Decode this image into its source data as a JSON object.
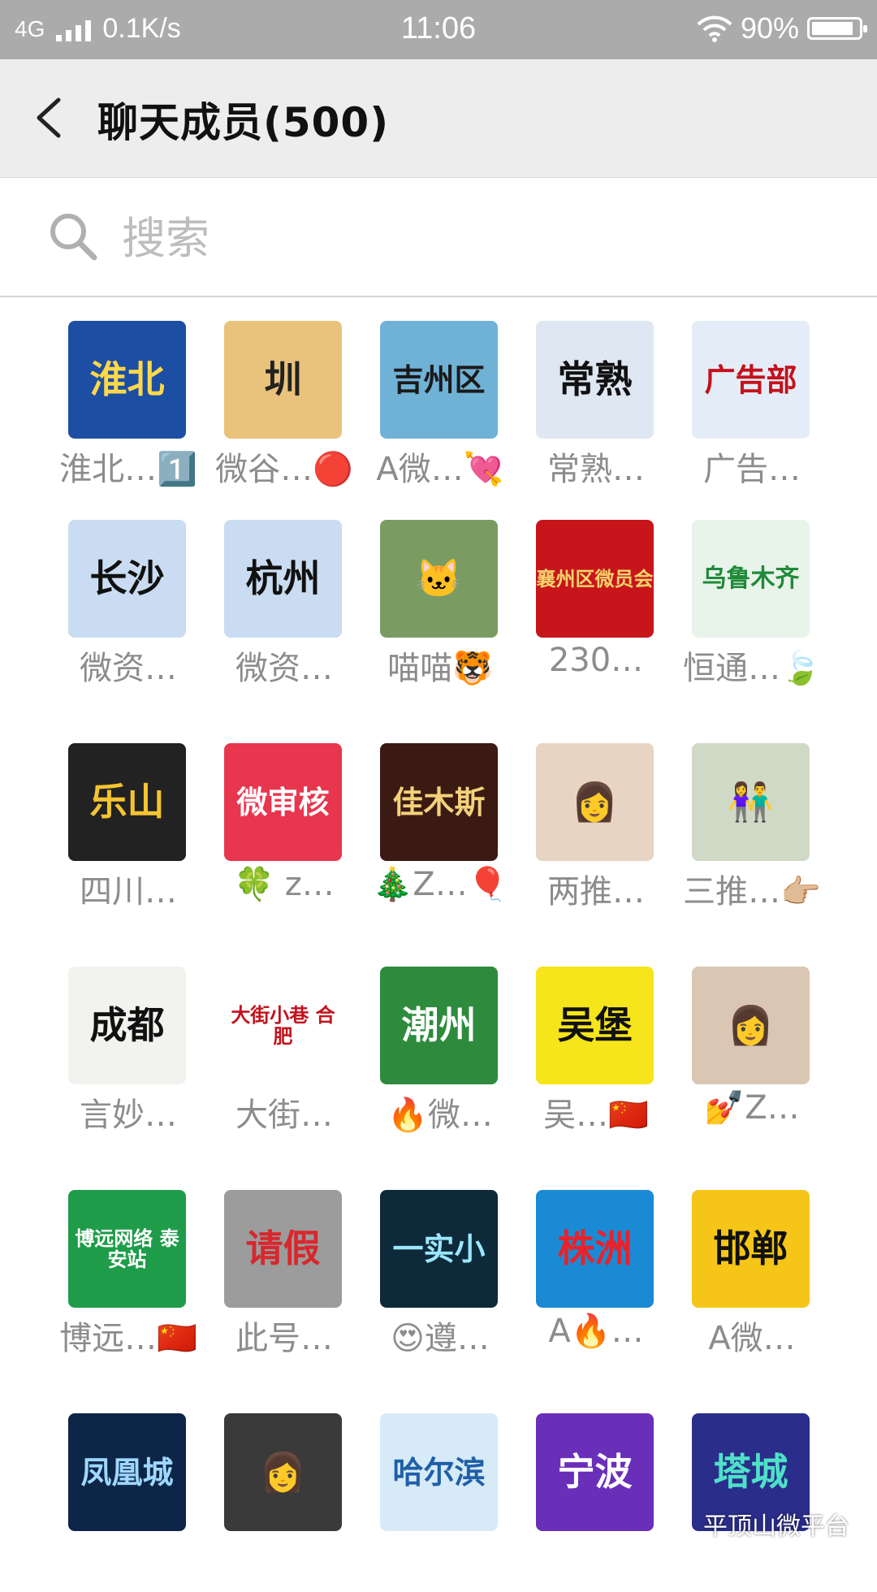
{
  "status_bar": {
    "network": "4G",
    "speed": "0.1K/s",
    "time": "11:06",
    "battery": "90%",
    "battery_level": 0.9
  },
  "nav": {
    "title": "聊天成员(500)"
  },
  "search": {
    "placeholder": "搜索"
  },
  "members": [
    {
      "name": "淮北…1️⃣",
      "avatar_text": "淮北",
      "bg": "#1c4fa3",
      "fg": "#ffd84a"
    },
    {
      "name": "微谷…🔴",
      "avatar_text": "圳",
      "bg": "#e9c27b",
      "fg": "#222222"
    },
    {
      "name": "A微…💘",
      "avatar_text": "吉州区",
      "bg": "#6fb2d6",
      "fg": "#1a1a1a"
    },
    {
      "name": "常熟…",
      "avatar_text": "常熟",
      "bg": "#dfe7f2",
      "fg": "#111111"
    },
    {
      "name": "广告…",
      "avatar_text": "广告部",
      "bg": "#e4edf7",
      "fg": "#c3121c"
    },
    {
      "name": "微资…",
      "avatar_text": "长沙",
      "bg": "#c9dcf2",
      "fg": "#111111"
    },
    {
      "name": "微资…",
      "avatar_text": "杭州",
      "bg": "#c9dcf2",
      "fg": "#111111"
    },
    {
      "name": "喵喵🐯",
      "avatar_text": "🐱",
      "bg": "#7a9c63",
      "fg": "#ffffff"
    },
    {
      "name": "230…",
      "avatar_text": "襄州区微员会",
      "bg": "#c8151b",
      "fg": "#f4d36b"
    },
    {
      "name": "恒通…🍃",
      "avatar_text": "乌鲁木齐",
      "bg": "#e8f3e9",
      "fg": "#1f8a3a"
    },
    {
      "name": "四川…",
      "avatar_text": "乐山",
      "bg": "#222222",
      "fg": "#f4c430"
    },
    {
      "name": "🍀 z…",
      "avatar_text": "微审核",
      "bg": "#e8364f",
      "fg": "#ffffff"
    },
    {
      "name": "🎄Z…🎈",
      "avatar_text": "佳木斯",
      "bg": "#3b1a14",
      "fg": "#f3d27a"
    },
    {
      "name": "两推…",
      "avatar_text": "👩",
      "bg": "#e7d4c2",
      "fg": "#5a3b2a"
    },
    {
      "name": "三推…👉🏼",
      "avatar_text": "👫",
      "bg": "#cfd9c6",
      "fg": "#333333"
    },
    {
      "name": "言妙…",
      "avatar_text": "成都",
      "bg": "#f2f2ee",
      "fg": "#111111"
    },
    {
      "name": "大街…",
      "avatar_text": "大街小巷 合肥",
      "bg": "#ffffff",
      "fg": "#c3121c"
    },
    {
      "name": "🔥微…",
      "avatar_text": "潮州",
      "bg": "#2e8b3e",
      "fg": "#ffffff"
    },
    {
      "name": "吴…🇨🇳",
      "avatar_text": "吴堡",
      "bg": "#f6e51b",
      "fg": "#111111"
    },
    {
      "name": "💅Z…",
      "avatar_text": "👩",
      "bg": "#d9c7b4",
      "fg": "#4a3526"
    },
    {
      "name": "博远…🇨🇳",
      "avatar_text": "博远网络 泰安站",
      "bg": "#1f9c4a",
      "fg": "#ffffff"
    },
    {
      "name": "此号…",
      "avatar_text": "请假",
      "bg": "#9c9c9c",
      "fg": "#d6282e"
    },
    {
      "name": "😍遵…",
      "avatar_text": "一实小",
      "bg": "#0e2a3a",
      "fg": "#9be7ff"
    },
    {
      "name": "A🔥…",
      "avatar_text": "株洲",
      "bg": "#1a8ad4",
      "fg": "#e8222a"
    },
    {
      "name": "A微…",
      "avatar_text": "邯郸",
      "bg": "#f5c518",
      "fg": "#111111"
    },
    {
      "name": "",
      "avatar_text": "凤凰城",
      "bg": "#0d2547",
      "fg": "#9fd8ff"
    },
    {
      "name": "",
      "avatar_text": "👩",
      "bg": "#3a3a3a",
      "fg": "#eeeeee"
    },
    {
      "name": "",
      "avatar_text": "哈尔滨",
      "bg": "#d6eaf7",
      "fg": "#1f5fa8"
    },
    {
      "name": "",
      "avatar_text": "宁波",
      "bg": "#6a2fb8",
      "fg": "#ffffff"
    },
    {
      "name": "",
      "avatar_text": "塔城",
      "bg": "#2a2d8a",
      "fg": "#4ee1c8"
    }
  ],
  "watermark": "平顶山微平台"
}
